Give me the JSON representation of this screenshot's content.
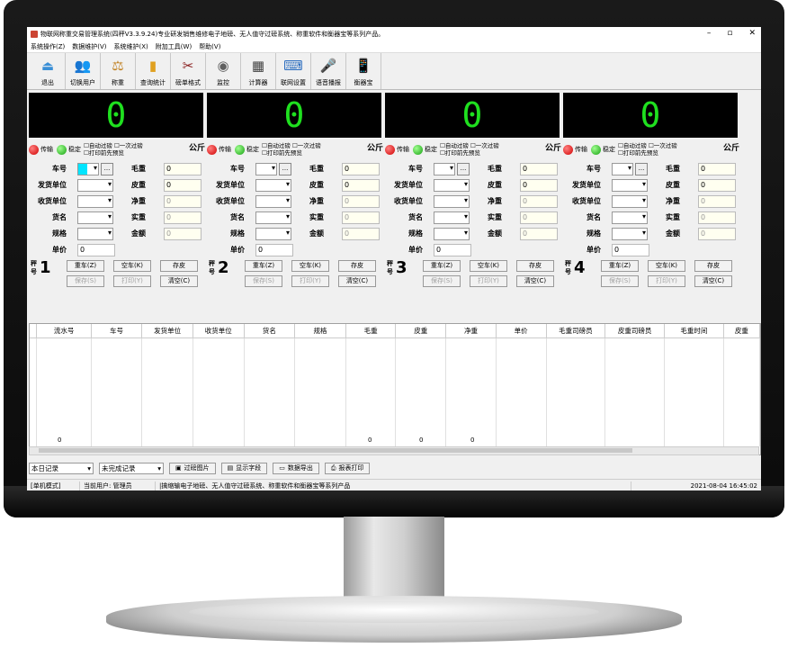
{
  "window": {
    "title": "物联网称重交易管理系统(四秤V3.3.9.24)专业研发销售维修电子地磅、无人值守过磅系统、称重软件和衡器宝等系列产品。",
    "controls": {
      "minimize": "–",
      "maximize": "▫",
      "close": "✕"
    }
  },
  "menu": [
    "系统操作(Z)",
    "数据维护(V)",
    "系统维护(X)",
    "附加工具(W)",
    "帮助(V)"
  ],
  "toolbar": [
    {
      "label": "退出",
      "icon": "exit-icon",
      "glyph": "⏏",
      "color": "#3a8fd6"
    },
    {
      "label": "切换用户",
      "icon": "users-icon",
      "glyph": "👥",
      "color": "#d09a40"
    },
    {
      "label": "称重",
      "icon": "scale-icon",
      "glyph": "⚖",
      "color": "#c08020"
    },
    {
      "label": "查询统计",
      "icon": "chart-icon",
      "glyph": "▮",
      "color": "#e0a020"
    },
    {
      "label": "磅单格式",
      "icon": "tools-icon",
      "glyph": "✂",
      "color": "#8a2020"
    },
    {
      "label": "监控",
      "icon": "camera-icon",
      "glyph": "◉",
      "color": "#606060"
    },
    {
      "label": "计算器",
      "icon": "calculator-icon",
      "glyph": "▦",
      "color": "#404040"
    },
    {
      "label": "联网设置",
      "icon": "network-icon",
      "glyph": "⌨",
      "color": "#3070c0"
    },
    {
      "label": "语音播报",
      "icon": "microphone-icon",
      "glyph": "🎤",
      "color": "#303030"
    },
    {
      "label": "衡器宝",
      "icon": "phone-icon",
      "glyph": "📱",
      "color": "#4090c0"
    }
  ],
  "scales": [
    {
      "reading": "0",
      "number": "1"
    },
    {
      "reading": "0",
      "number": "2"
    },
    {
      "reading": "0",
      "number": "3"
    },
    {
      "reading": "0",
      "number": "4"
    }
  ],
  "status": {
    "transfer": "传输",
    "stable": "稳定",
    "auto_weigh": "自动过磅",
    "one_time": "一次过磅",
    "print_preview": "打印前先预览",
    "unit": "公斤"
  },
  "form": {
    "labels_left": [
      "车号",
      "发货单位",
      "收货单位",
      "货名",
      "规格",
      "单价"
    ],
    "labels_right": [
      "毛重",
      "皮重",
      "净重",
      "实重",
      "金额"
    ],
    "weights": [
      "0",
      "0",
      "0",
      "0",
      "0"
    ],
    "price": "0",
    "dots": "..."
  },
  "scale_label": "秤号",
  "buttons": {
    "gross": "重车(Z)",
    "tare_car": "空车(K)",
    "tare": "存皮",
    "save": "保存(S)",
    "print": "打印(Y)",
    "clear": "清空(C)"
  },
  "table": {
    "columns": [
      "流水号",
      "车号",
      "发货单位",
      "收货单位",
      "货名",
      "规格",
      "毛重",
      "皮重",
      "净重",
      "单价",
      "毛重司磅员",
      "皮重司磅员",
      "毛重时间",
      "皮重"
    ],
    "sums": {
      "serial": "0",
      "gross": "0",
      "tare": "0",
      "net": "0"
    }
  },
  "bottom": {
    "filter1": "本日记录",
    "filter2": "未完成记录",
    "btn_images": "过磅图片",
    "btn_fields": "显示字段",
    "btn_export": "数据导出",
    "btn_print": "报表打印"
  },
  "statusbar": {
    "mode": "[单机模式]",
    "user": "当前用户: 管理员",
    "slogan": "|擒缩输电子地磅、无人值守过磅系统、称重软件和衡器宝等系列产品",
    "datetime": "2021-08-04 16:45:02"
  }
}
